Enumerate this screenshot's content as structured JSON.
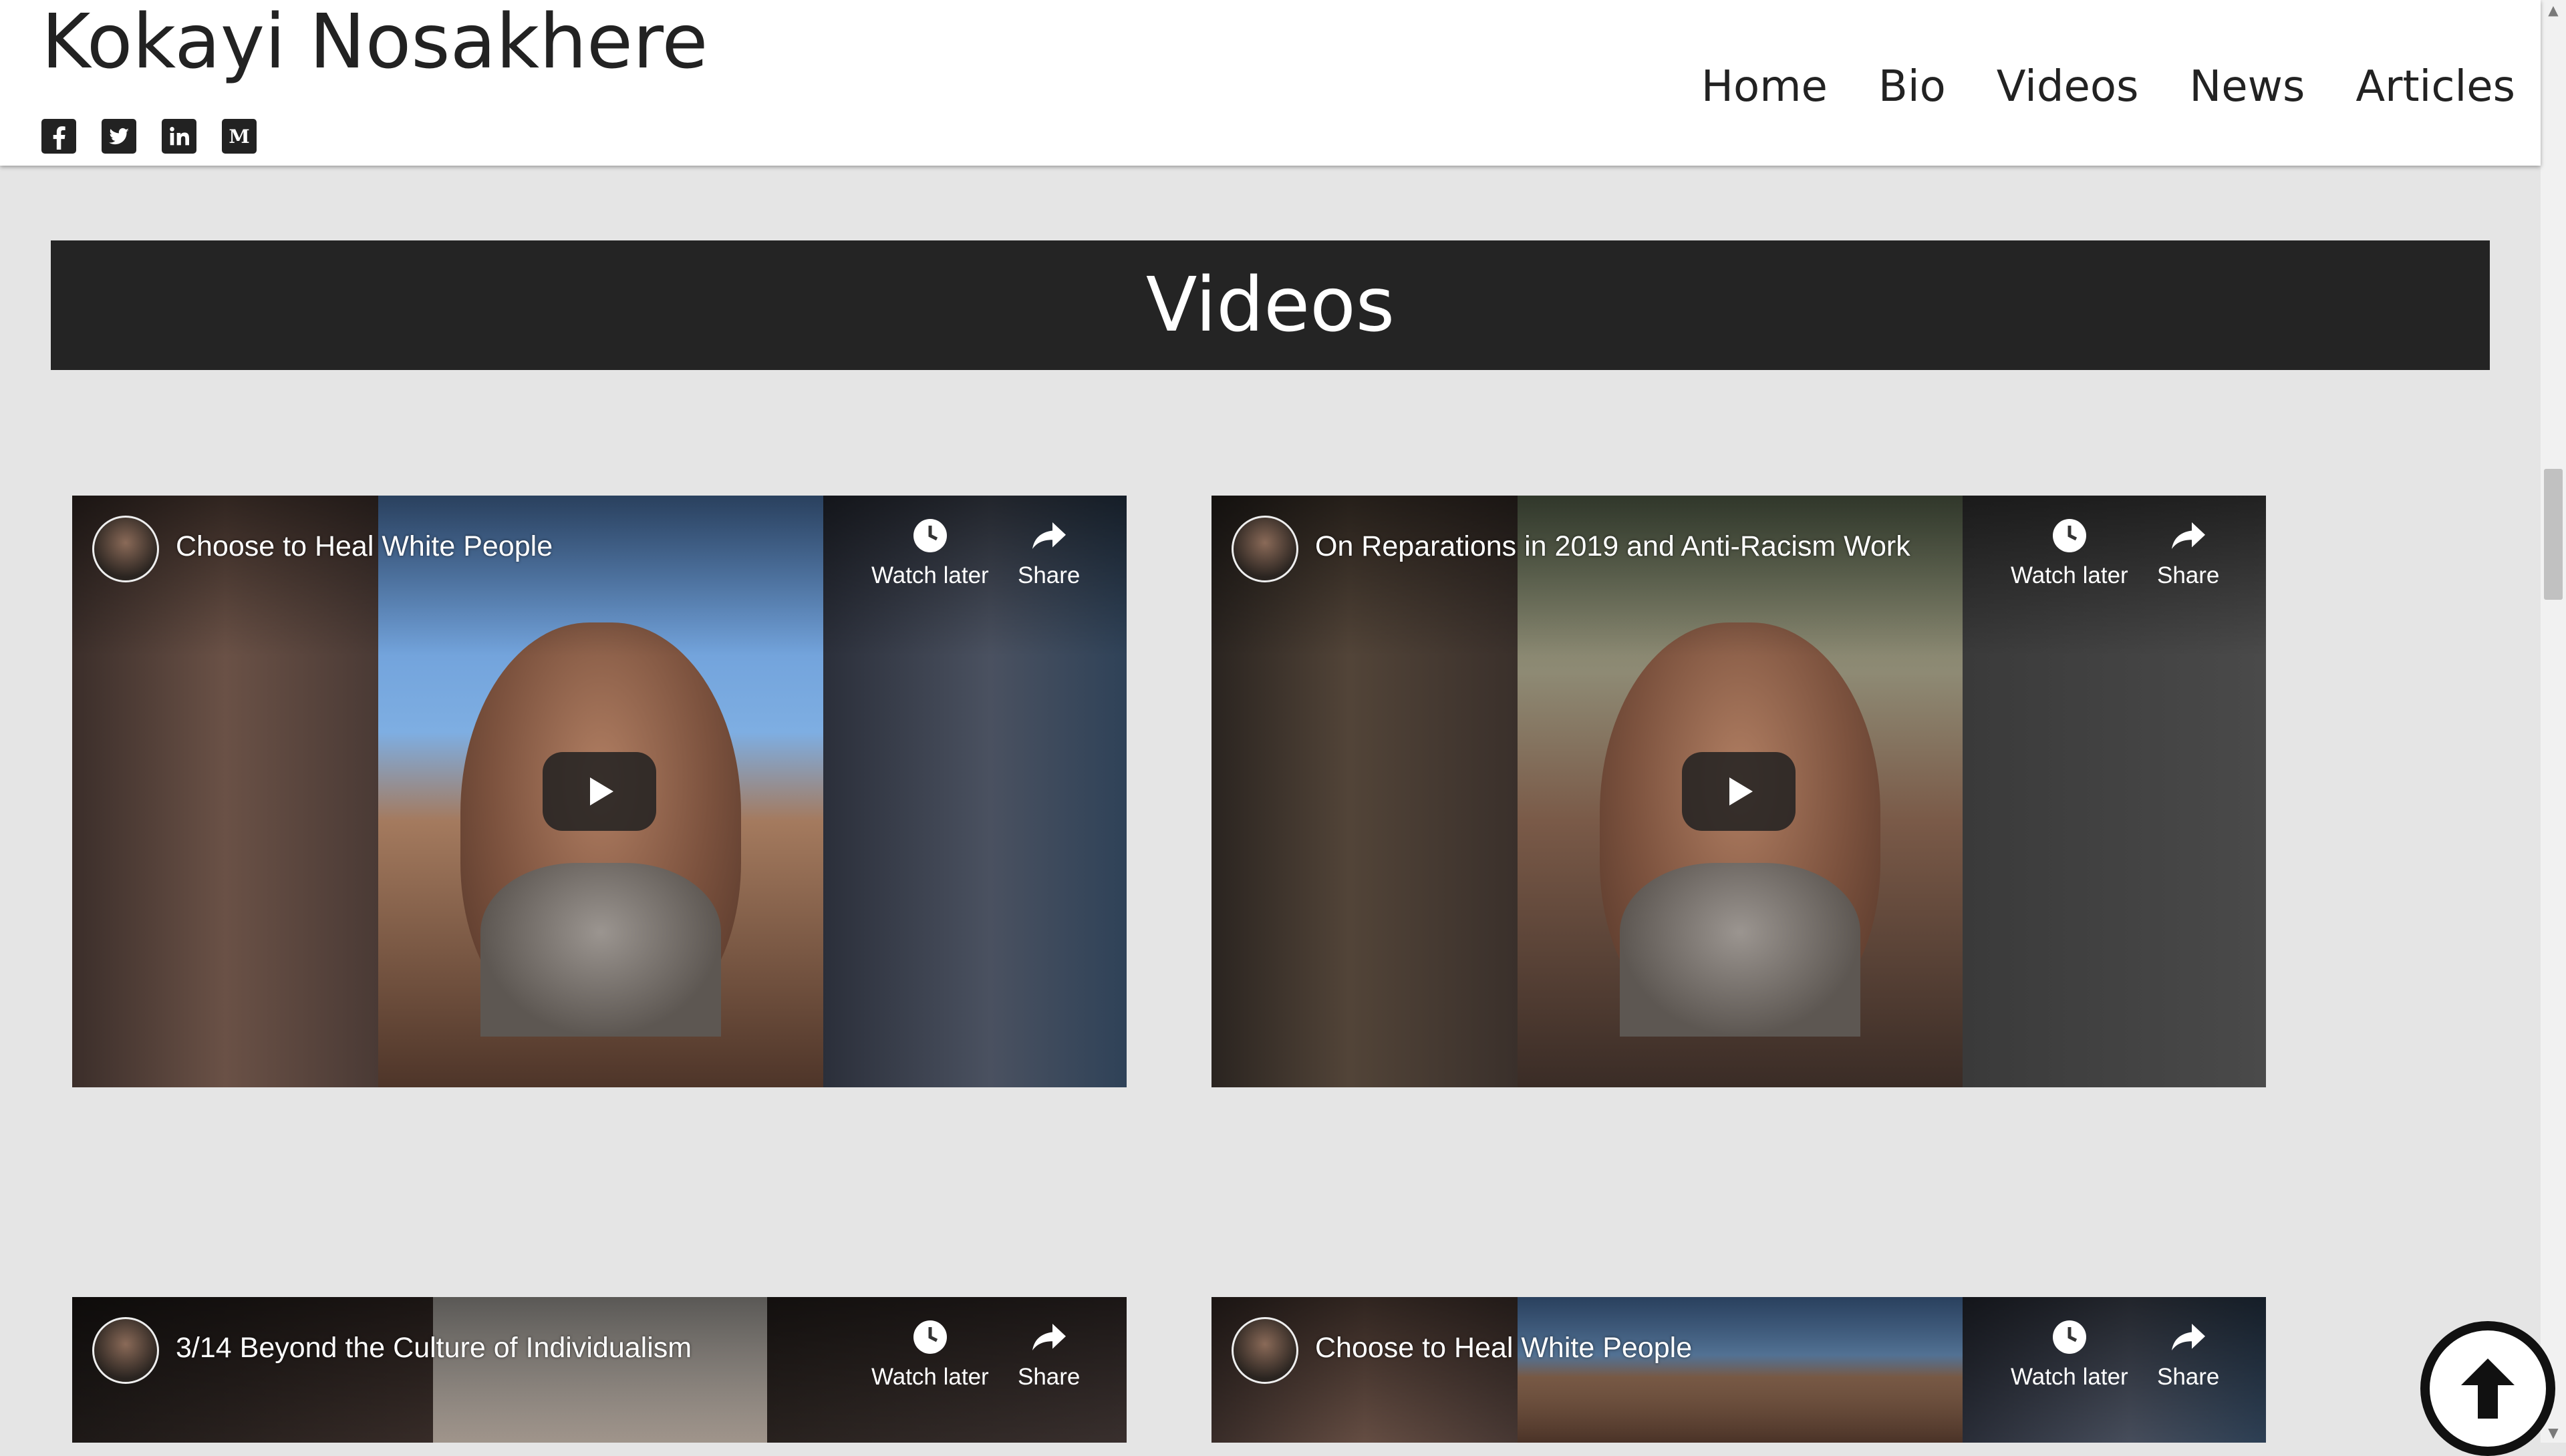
{
  "site": {
    "title": "Kokayi Nosakhere",
    "socials": [
      "facebook-icon",
      "twitter-icon",
      "linkedin-icon",
      "medium-icon"
    ]
  },
  "nav": {
    "items": [
      {
        "label": "Home"
      },
      {
        "label": "Bio"
      },
      {
        "label": "Videos"
      },
      {
        "label": "News"
      },
      {
        "label": "Articles"
      }
    ]
  },
  "section": {
    "heading": "Videos"
  },
  "videos": [
    {
      "title": "Choose to Heal White People",
      "watch_later": "Watch later",
      "share": "Share"
    },
    {
      "title": "On Reparations in 2019 and Anti-Racism Work",
      "watch_later": "Watch later",
      "share": "Share"
    },
    {
      "title": "3/14 Beyond the Culture of Individualism",
      "watch_later": "Watch later",
      "share": "Share"
    },
    {
      "title": "Choose to Heal White People",
      "watch_later": "Watch later",
      "share": "Share"
    }
  ],
  "colors": {
    "banner": "#242424",
    "page_background": "#e5e5e5",
    "header_background": "#ffffff",
    "text": "#222222"
  }
}
